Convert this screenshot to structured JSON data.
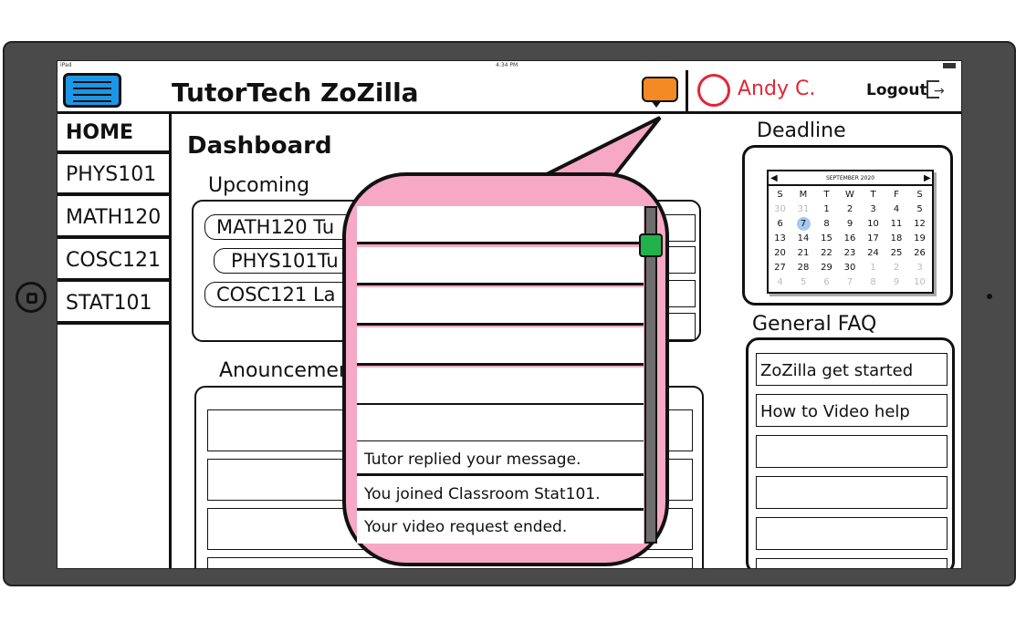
{
  "status_bar": {
    "device": "iPad",
    "time": "4:34 PM"
  },
  "header": {
    "app_title": "TutorTech ZoZilla",
    "menu_icon": "hamburger-icon",
    "chat_icon": "chat-bubble-icon",
    "user_name": "Andy C.",
    "logout_label": "Logout",
    "logout_icon": "logout-door-icon"
  },
  "sidebar": {
    "items": [
      {
        "label": "HOME"
      },
      {
        "label": "PHYS101"
      },
      {
        "label": "MATH120"
      },
      {
        "label": "COSC121"
      },
      {
        "label": "STAT101"
      }
    ]
  },
  "main": {
    "page_title": "Dashboard",
    "upcoming": {
      "label": "Upcoming",
      "items": [
        "MATH120 Tu",
        "PHYS101Tu",
        "COSC121 La"
      ]
    },
    "announcements": {
      "label": "Anouncements"
    }
  },
  "deadline": {
    "label": "Deadline",
    "calendar": {
      "month": "SEPTEMBER 2020",
      "weekdays": [
        "S",
        "M",
        "T",
        "W",
        "T",
        "F",
        "S"
      ],
      "weeks": [
        [
          "30",
          "31",
          "1",
          "2",
          "3",
          "4",
          "5"
        ],
        [
          "6",
          "7",
          "8",
          "9",
          "10",
          "11",
          "12"
        ],
        [
          "13",
          "14",
          "15",
          "16",
          "17",
          "18",
          "19"
        ],
        [
          "20",
          "21",
          "22",
          "23",
          "24",
          "25",
          "26"
        ],
        [
          "27",
          "28",
          "29",
          "30",
          "1",
          "2",
          "3"
        ],
        [
          "4",
          "5",
          "6",
          "7",
          "8",
          "9",
          "10"
        ]
      ],
      "selected_day": "7"
    }
  },
  "faq": {
    "label": "General FAQ",
    "items": [
      "ZoZilla get started",
      "How to Video help",
      "",
      "",
      "",
      ""
    ]
  },
  "notifications": {
    "items": [
      "",
      "",
      "",
      "",
      "",
      "",
      "Tutor replied your message.",
      "You joined Classroom Stat101.",
      "Your video request ended."
    ],
    "scroll_position": 0.1
  },
  "colors": {
    "menu_button": "#1e96e6",
    "chat_icon": "#f58a24",
    "user_accent": "#e32636",
    "popup_background": "#f7a8c4",
    "scroll_thumb": "#21b24c",
    "tablet_frame": "#4a4a4a"
  }
}
